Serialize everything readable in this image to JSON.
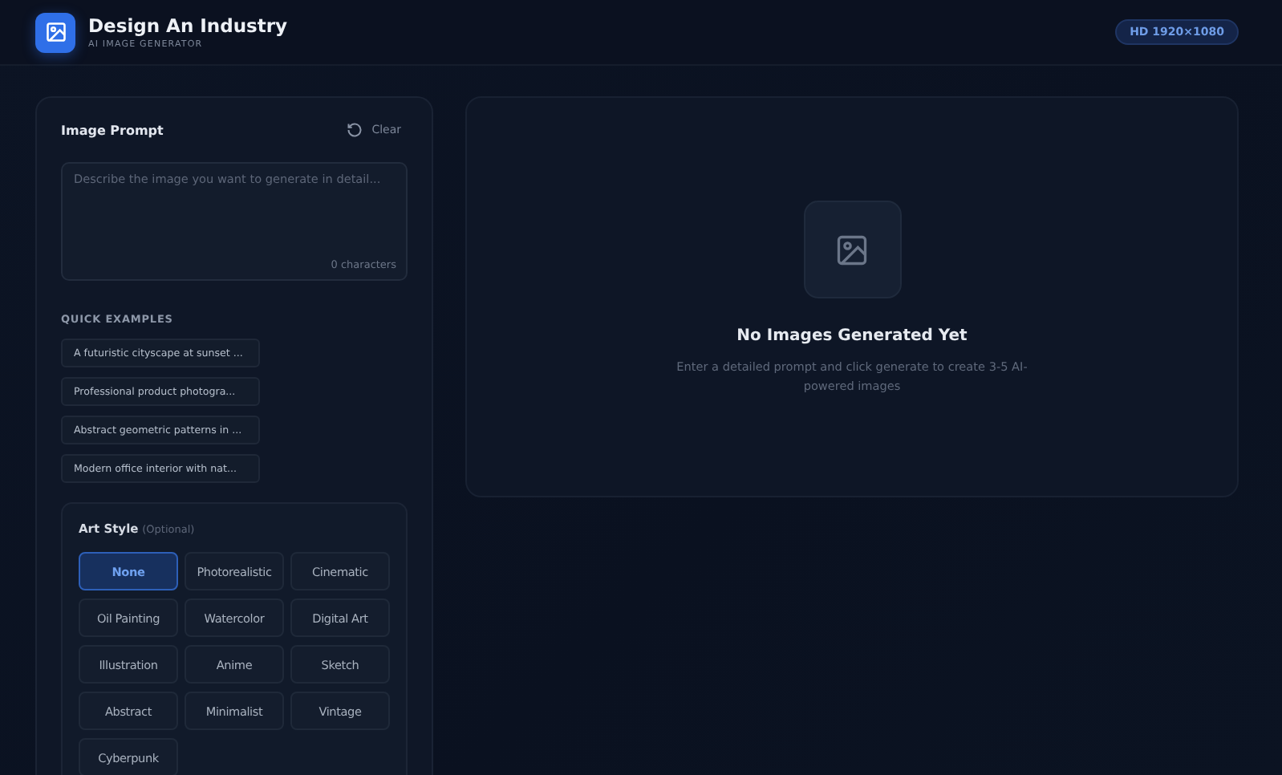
{
  "header": {
    "title": "Design An Industry",
    "subtitle": "AI IMAGE GENERATOR",
    "badge": "HD 1920×1080"
  },
  "prompt": {
    "heading": "Image Prompt",
    "clear": "Clear",
    "placeholder": "Describe the image you want to generate in detail...",
    "counter": "0 characters"
  },
  "quick_examples": {
    "heading": "QUICK EXAMPLES",
    "items": [
      "A futuristic cityscape at sunset ...",
      "Professional product photogra...",
      "Abstract geometric patterns in ...",
      "Modern office interior with nat..."
    ]
  },
  "art_style": {
    "heading": "Art Style",
    "note": "(Optional)",
    "options": [
      {
        "label": "None",
        "selected": true
      },
      {
        "label": "Photorealistic",
        "selected": false
      },
      {
        "label": "Cinematic",
        "selected": false
      },
      {
        "label": "Oil Painting",
        "selected": false
      },
      {
        "label": "Watercolor",
        "selected": false
      },
      {
        "label": "Digital Art",
        "selected": false
      },
      {
        "label": "Illustration",
        "selected": false
      },
      {
        "label": "Anime",
        "selected": false
      },
      {
        "label": "Sketch",
        "selected": false
      },
      {
        "label": "Abstract",
        "selected": false
      },
      {
        "label": "Minimalist",
        "selected": false
      },
      {
        "label": "Vintage",
        "selected": false
      },
      {
        "label": "Cyberpunk",
        "selected": false
      }
    ]
  },
  "empty_state": {
    "title": "No Images Generated Yet",
    "text": "Enter a detailed prompt and click generate to create 3-5 AI-powered images"
  }
}
